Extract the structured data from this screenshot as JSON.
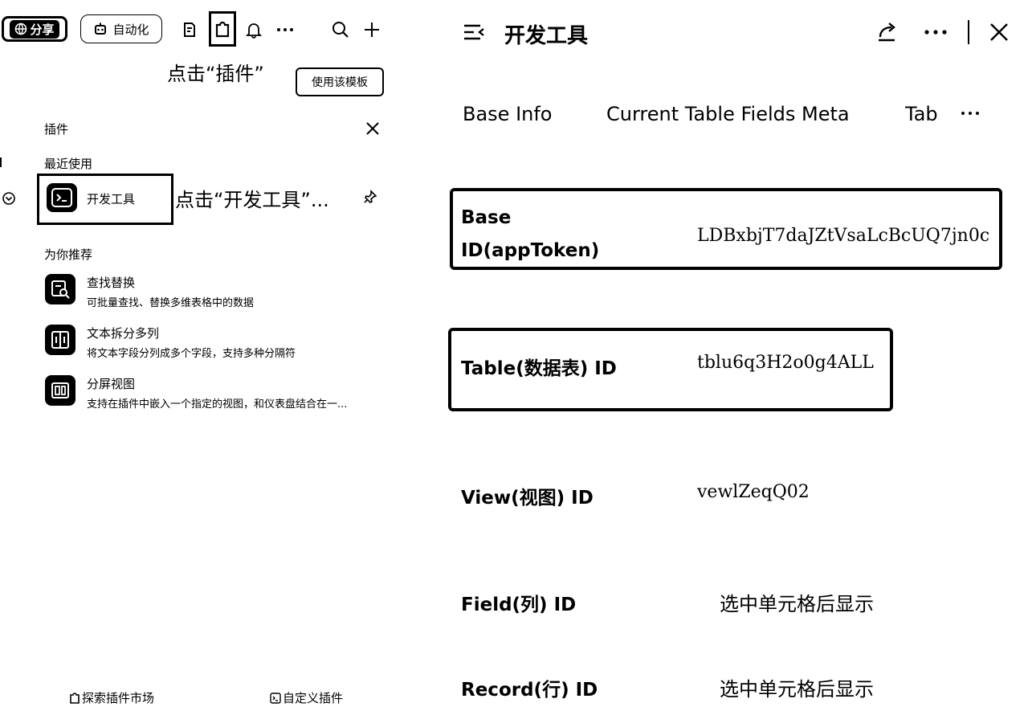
{
  "toolbar": {
    "share_label": "分享",
    "automation_label": "自动化",
    "icons": [
      "form-icon",
      "plugin-icon",
      "bell-icon",
      "more-icon",
      "search-icon",
      "plus-icon"
    ]
  },
  "annotations": {
    "click_plugin": "点击“插件”",
    "click_devtool": "点击“开发工具”..."
  },
  "template_button": "使用该模板",
  "plugin_panel": {
    "title": "插件",
    "recent_title": "最近使用",
    "recent_item": "开发工具",
    "recommend_title": "为你推荐",
    "recommendations": [
      {
        "title": "查找替换",
        "desc": "可批量查找、替换多维表格中的数据"
      },
      {
        "title": "文本拆分多列",
        "desc": "将文本字段分列成多个字段，支持多种分隔符"
      },
      {
        "title": "分屏视图",
        "desc": "支持在插件中嵌入一个指定的视图，和仪表盘结合在一..."
      }
    ],
    "footer_left": "探索插件市场",
    "footer_right": "自定义插件"
  },
  "devtool": {
    "title": "开发工具",
    "tabs": [
      "Base Info",
      "Current Table Fields Meta",
      "Tab"
    ],
    "rows": [
      {
        "label_line1": "Base",
        "label_line2": "ID(appToken)",
        "value": "LDBxbjT7daJZtVsaLcBcUQ7jn0c"
      },
      {
        "label": "Table(数据表) ID",
        "value": "tblu6q3H2o0g4ALL"
      },
      {
        "label": "View(视图) ID",
        "value": "vewlZeqQ02"
      },
      {
        "label": "Field(列) ID",
        "value": "选中单元格后显示"
      },
      {
        "label": "Record(行) ID",
        "value": "选中单元格后显示"
      }
    ]
  }
}
